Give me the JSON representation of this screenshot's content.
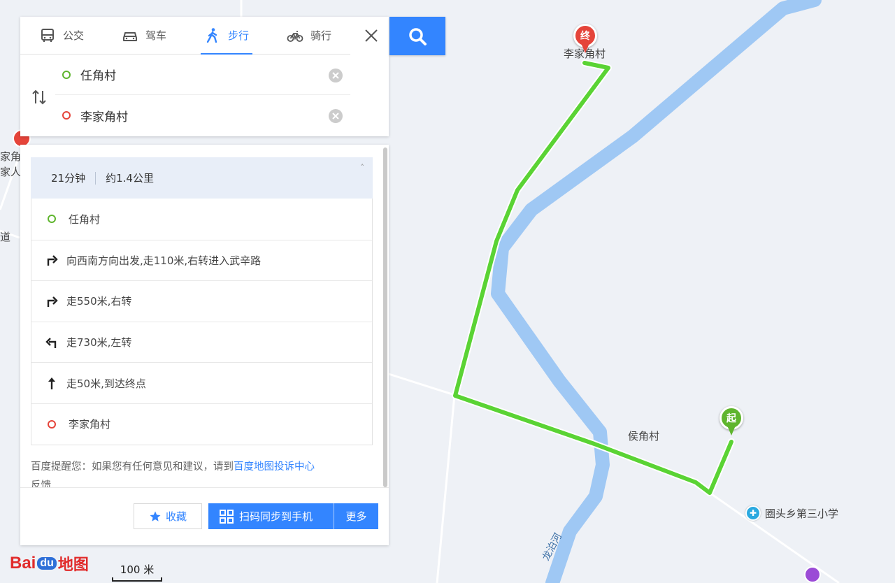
{
  "modes": [
    {
      "label": "公交",
      "icon": "bus-icon",
      "active": false
    },
    {
      "label": "驾车",
      "icon": "car-icon",
      "active": false
    },
    {
      "label": "步行",
      "icon": "walk-icon",
      "active": true
    },
    {
      "label": "骑行",
      "icon": "bike-icon",
      "active": false
    }
  ],
  "route": {
    "origin": "任角村",
    "destination": "李家角村"
  },
  "summary": {
    "duration": "21分钟",
    "distance": "约1.4公里"
  },
  "steps": [
    {
      "icon": "origin-ring-icon",
      "text": "任角村"
    },
    {
      "icon": "turn-right-icon",
      "text": "向西南方向出发,走110米,右转进入武辛路"
    },
    {
      "icon": "turn-right-icon",
      "text": "走550米,右转"
    },
    {
      "icon": "turn-left-icon",
      "text": "走730米,左转"
    },
    {
      "icon": "straight-icon",
      "text": "走50米,到达终点"
    },
    {
      "icon": "destination-ring-icon",
      "text": "李家角村"
    }
  ],
  "notice": {
    "prefix": "百度提醒您：如果您有任何意见和建议，请到",
    "link": "百度地图投诉中心",
    "suffix": "反馈"
  },
  "actions": {
    "favorite": "收藏",
    "sync": "扫码同步到手机",
    "more": "更多"
  },
  "map": {
    "labels": {
      "end_place": "李家角村",
      "mid_place": "侯角村",
      "school": "圈头乡第三小学",
      "river": "龙泊河",
      "left_edge_1": "家角",
      "left_edge_2": "家人",
      "left_edge_3": "道"
    },
    "pins": {
      "end": "终",
      "start": "起"
    },
    "scale": "100 米"
  },
  "branding": {
    "bai": "Bai",
    "du": "du",
    "map": "地图"
  },
  "colors": {
    "accent": "#3385ff",
    "route": "#5ad334",
    "river": "#9fc8f4",
    "start": "#5fb52e",
    "end": "#e5443a"
  }
}
